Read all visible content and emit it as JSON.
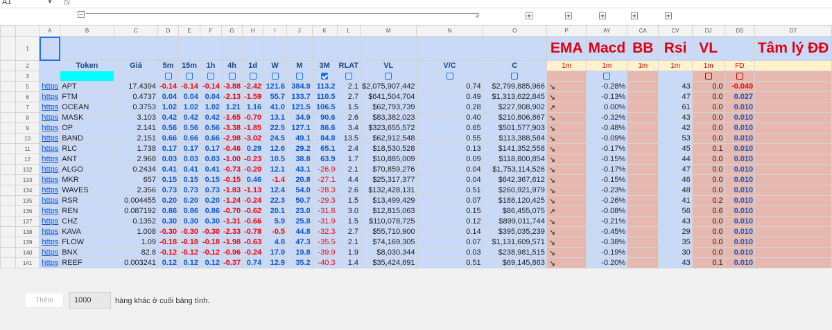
{
  "toolbar": {
    "name_box": "A1",
    "fx": "fx"
  },
  "columns": [
    "",
    "A",
    "B",
    "C",
    "D",
    "E",
    "F",
    "G",
    "H",
    "I",
    "J",
    "K",
    "L",
    "M",
    "N",
    "O",
    "P",
    "AY",
    "CA",
    "CV",
    "DJ",
    "DS",
    "DT"
  ],
  "row1": {
    "num": "1",
    "ema": "EMA",
    "macd": "Macd",
    "bb": "BB",
    "rsi": "Rsi",
    "vl": "VL",
    "tamly": "Tâm lý ĐĐ"
  },
  "row2": {
    "num": "2",
    "headers": [
      "",
      "Token",
      "Giá",
      "5m",
      "15m",
      "1h",
      "4h",
      "1d",
      "W",
      "M",
      "3M",
      "RLAT",
      "VL",
      "V/C",
      "C"
    ],
    "tf": [
      "1m",
      "1m",
      "1m",
      "1m",
      "1m",
      "FD",
      ""
    ]
  },
  "row3": {
    "num": "3"
  },
  "rows": [
    {
      "num": "5",
      "link": "https",
      "token": "APT",
      "price": "17.4394",
      "m5": "-0.14",
      "m15": "-0.14",
      "h1": "-0.14",
      "h4": "-3.88",
      "d1": "-2.42",
      "w": "121.6",
      "m": "384.9",
      "m3": "113.2",
      "rlat": "2.1",
      "vl": "$2,075,907,442",
      "vc": "0.74",
      "c": "$2,799,885,966",
      "ema": "↘",
      "macd": "-0.28%",
      "rsi": "43",
      "vlv": "0.0",
      "fd": "-0.049"
    },
    {
      "num": "6",
      "link": "https",
      "token": "FTM",
      "price": "0.4737",
      "m5": "0.04",
      "m15": "0.04",
      "h1": "0.04",
      "h4": "-2.13",
      "d1": "-1.59",
      "w": "55.7",
      "m": "133.7",
      "m3": "110.5",
      "rlat": "2.7",
      "vl": "$641,504,704",
      "vc": "0.49",
      "c": "$1,313,622,845",
      "ema": "↘",
      "macd": "-0.13%",
      "rsi": "47",
      "vlv": "0.0",
      "fd": "0.027"
    },
    {
      "num": "7",
      "link": "https",
      "token": "OCEAN",
      "price": "0.3753",
      "m5": "1.02",
      "m15": "1.02",
      "h1": "1.02",
      "h4": "1.21",
      "d1": "1.16",
      "w": "41.0",
      "m": "121.5",
      "m3": "106.5",
      "rlat": "1.5",
      "vl": "$62,793,739",
      "vc": "0.28",
      "c": "$227,908,902",
      "ema": "↗",
      "macd": "0.00%",
      "rsi": "61",
      "vlv": "0.0",
      "fd": "0.010"
    },
    {
      "num": "8",
      "link": "https",
      "token": "MASK",
      "price": "3.103",
      "m5": "0.42",
      "m15": "0.42",
      "h1": "0.42",
      "h4": "-1.65",
      "d1": "-0.70",
      "w": "13.1",
      "m": "34.9",
      "m3": "90.6",
      "rlat": "2.6",
      "vl": "$83,382,023",
      "vc": "0.40",
      "c": "$210,806,867",
      "ema": "↘",
      "macd": "-0.32%",
      "rsi": "43",
      "vlv": "0.0",
      "fd": "0.010"
    },
    {
      "num": "9",
      "link": "https",
      "token": "OP",
      "price": "2.141",
      "m5": "0.56",
      "m15": "0.56",
      "h1": "0.56",
      "h4": "-3.38",
      "d1": "-1.85",
      "w": "22.5",
      "m": "127.1",
      "m3": "86.6",
      "rlat": "3.4",
      "vl": "$323,655,572",
      "vc": "0.65",
      "c": "$501,577,903",
      "ema": "↘",
      "macd": "-0.48%",
      "rsi": "42",
      "vlv": "0.0",
      "fd": "0.010"
    },
    {
      "num": "10",
      "link": "https",
      "token": "BAND",
      "price": "2.151",
      "m5": "0.66",
      "m15": "0.66",
      "h1": "0.66",
      "h4": "-2.98",
      "d1": "-3.02",
      "w": "24.5",
      "m": "49.1",
      "m3": "84.8",
      "rlat": "13.5",
      "vl": "$62,912,548",
      "vc": "0.55",
      "c": "$113,388,584",
      "ema": "↘",
      "macd": "-0.09%",
      "rsi": "53",
      "vlv": "0.0",
      "fd": "0.010"
    },
    {
      "num": "11",
      "link": "https",
      "token": "RLC",
      "price": "1.738",
      "m5": "0.17",
      "m15": "0.17",
      "h1": "0.17",
      "h4": "-0.46",
      "d1": "0.29",
      "w": "12.6",
      "m": "29.2",
      "m3": "65.1",
      "rlat": "2.4",
      "vl": "$18,530,528",
      "vc": "0.13",
      "c": "$141,352,558",
      "ema": "↘",
      "macd": "-0.17%",
      "rsi": "45",
      "vlv": "0.1",
      "fd": "0.010"
    },
    {
      "num": "12",
      "link": "https",
      "token": "ANT",
      "price": "2.968",
      "m5": "0.03",
      "m15": "0.03",
      "h1": "0.03",
      "h4": "-1.00",
      "d1": "-0.23",
      "w": "10.5",
      "m": "38.8",
      "m3": "63.9",
      "rlat": "1.7",
      "vl": "$10,885,009",
      "vc": "0.09",
      "c": "$118,800,854",
      "ema": "↘",
      "macd": "-0.15%",
      "rsi": "44",
      "vlv": "0.0",
      "fd": "0.010"
    },
    {
      "num": "132",
      "link": "https",
      "token": "ALGO",
      "price": "0.2434",
      "m5": "0.41",
      "m15": "0.41",
      "h1": "0.41",
      "h4": "-0.73",
      "d1": "-0.20",
      "w": "12.1",
      "m": "43.1",
      "m3": "-26.9",
      "rlat": "2.1",
      "vl": "$70,859,276",
      "vc": "0.04",
      "c": "$1,753,114,526",
      "ema": "↘",
      "macd": "-0.17%",
      "rsi": "47",
      "vlv": "0.0",
      "fd": "0.010"
    },
    {
      "num": "133",
      "link": "https",
      "token": "MKR",
      "price": "657",
      "m5": "0.15",
      "m15": "0.15",
      "h1": "0.15",
      "h4": "-0.15",
      "d1": "0.46",
      "w": "-1.4",
      "m": "20.8",
      "m3": "-27.1",
      "rlat": "4.4",
      "vl": "$25,317,377",
      "vc": "0.04",
      "c": "$642,367,612",
      "ema": "↘",
      "macd": "-0.15%",
      "rsi": "46",
      "vlv": "0.0",
      "fd": "0.010"
    },
    {
      "num": "134",
      "link": "https",
      "token": "WAVES",
      "price": "2.356",
      "m5": "0.73",
      "m15": "0.73",
      "h1": "0.73",
      "h4": "-1.83",
      "d1": "-1.13",
      "w": "12.4",
      "m": "54.0",
      "m3": "-28.3",
      "rlat": "2.6",
      "vl": "$132,428,131",
      "vc": "0.51",
      "c": "$260,921,979",
      "ema": "↘",
      "macd": "-0.23%",
      "rsi": "48",
      "vlv": "0.0",
      "fd": "0.010"
    },
    {
      "num": "135",
      "link": "https",
      "token": "RSR",
      "price": "0.004455",
      "m5": "0.20",
      "m15": "0.20",
      "h1": "0.20",
      "h4": "-1.24",
      "d1": "-0.24",
      "w": "22.3",
      "m": "50.7",
      "m3": "-29.3",
      "rlat": "1.5",
      "vl": "$13,499,429",
      "vc": "0.07",
      "c": "$188,120,425",
      "ema": "↘",
      "macd": "-0.26%",
      "rsi": "41",
      "vlv": "0.2",
      "fd": "0.010"
    },
    {
      "num": "136",
      "link": "https",
      "token": "REN",
      "price": "0.087192",
      "m5": "0.86",
      "m15": "0.86",
      "h1": "0.86",
      "h4": "-0.70",
      "d1": "-0.62",
      "w": "20.1",
      "m": "23.0",
      "m3": "-31.8",
      "rlat": "3.0",
      "vl": "$12,815,063",
      "vc": "0.15",
      "c": "$86,455,075",
      "ema": "↗",
      "macd": "-0.08%",
      "rsi": "56",
      "vlv": "0.6",
      "fd": "0.010"
    },
    {
      "num": "137",
      "link": "https",
      "token": "CHZ",
      "price": "0.1352",
      "m5": "0.30",
      "m15": "0.30",
      "h1": "0.30",
      "h4": "-1.31",
      "d1": "-0.66",
      "w": "5.9",
      "m": "25.8",
      "m3": "-31.9",
      "rlat": "1.5",
      "vl": "$110,078,725",
      "vc": "0.12",
      "c": "$899,011,744",
      "ema": "↘",
      "macd": "-0.21%",
      "rsi": "43",
      "vlv": "0.0",
      "fd": "0.010"
    },
    {
      "num": "138",
      "link": "https",
      "token": "KAVA",
      "price": "1.008",
      "m5": "-0.30",
      "m15": "-0.30",
      "h1": "-0.30",
      "h4": "-2.33",
      "d1": "-0.78",
      "w": "-0.5",
      "m": "44.8",
      "m3": "-32.3",
      "rlat": "2.7",
      "vl": "$55,710,900",
      "vc": "0.14",
      "c": "$395,035,239",
      "ema": "↘",
      "macd": "-0.45%",
      "rsi": "29",
      "vlv": "0.0",
      "fd": "0.010"
    },
    {
      "num": "139",
      "link": "https",
      "token": "FLOW",
      "price": "1.09",
      "m5": "-0.18",
      "m15": "-0.18",
      "h1": "-0.18",
      "h4": "-1.98",
      "d1": "-0.63",
      "w": "4.8",
      "m": "47.3",
      "m3": "-35.5",
      "rlat": "2.1",
      "vl": "$74,169,305",
      "vc": "0.07",
      "c": "$1,131,609,571",
      "ema": "↘",
      "macd": "-0.38%",
      "rsi": "35",
      "vlv": "0.0",
      "fd": "0.010"
    },
    {
      "num": "140",
      "link": "https",
      "token": "BNX",
      "price": "82.8",
      "m5": "-0.12",
      "m15": "-0.12",
      "h1": "-0.12",
      "h4": "-0.96",
      "d1": "-0.24",
      "w": "17.9",
      "m": "19.8",
      "m3": "-39.9",
      "rlat": "1.9",
      "vl": "$8,030,344",
      "vc": "0.03",
      "c": "$238,981,515",
      "ema": "↘",
      "macd": "-0.19%",
      "rsi": "30",
      "vlv": "0.0",
      "fd": "0.010"
    },
    {
      "num": "141",
      "link": "https",
      "token": "REEF",
      "price": "0.003241",
      "m5": "0.12",
      "m15": "0.12",
      "h1": "0.12",
      "h4": "-0.37",
      "d1": "0.74",
      "w": "12.9",
      "m": "35.2",
      "m3": "-40.3",
      "rlat": "1.4",
      "vl": "$35,424,691",
      "vc": "0.51",
      "c": "$69,145,863",
      "ema": "↘",
      "macd": "-0.20%",
      "rsi": "43",
      "vlv": "0.1",
      "fd": "0.010"
    }
  ],
  "footer": {
    "add_button": "Thêm",
    "rows_count": "1000",
    "suffix": "hàng khác ở cuối bảng tính."
  },
  "colors": {
    "header_blue": "#c9daf8",
    "indicator_pink": "#e6b8af",
    "timeframe_yellow": "#fff2cc",
    "token_cyan": "#00ffff",
    "accent_red": "#ff0000",
    "accent_blue": "#1155cc"
  }
}
